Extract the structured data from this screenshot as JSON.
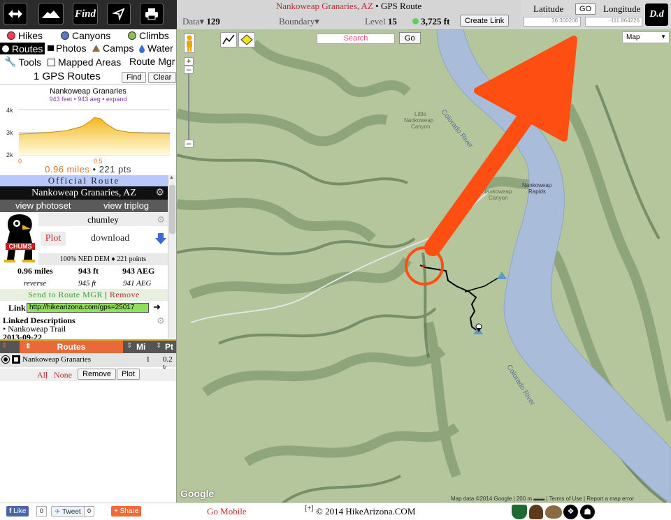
{
  "topbar": {
    "find_label": "Find",
    "title_place": "Nankoweap Granaries, AZ",
    "title_sep": " • ",
    "title_type": "GPS Route",
    "data_label": "Data",
    "data_value": "129",
    "boundary_label": "Boundary",
    "level_label": "Level",
    "level_value": "15",
    "elevation": "3,725 ft",
    "create_link": "Create Link",
    "latitude_label": "Latitude",
    "longitude_label": "Longitude",
    "go_label": "GO",
    "lat_value": "36.300206",
    "lng_value": "-111.864226",
    "dd_label": "D.d"
  },
  "categories": {
    "hikes": "Hikes",
    "canyons": "Canyons",
    "climbs": "Climbs",
    "routes": "Routes",
    "photos": "Photos",
    "camps": "Camps",
    "water": "Water",
    "tools": "Tools",
    "mapped_areas": "Mapped Areas",
    "route_mgr": "Route Mgr"
  },
  "gps": {
    "count_label": "1 GPS Routes",
    "find": "Find",
    "clear": "Clear",
    "route_name": "Nankoweap Granaries",
    "stats_small": "943 feet • 943 aeg • expand",
    "y_ticks": [
      "4k",
      "3k",
      "2k"
    ],
    "x_ticks": [
      "0",
      "0.5"
    ],
    "distance": "0.96 miles",
    "points": "221 pts"
  },
  "profile_chart": {
    "ylim_k": [
      2,
      4
    ],
    "xlim": [
      0,
      0.96
    ],
    "x": [
      0,
      0.1,
      0.2,
      0.3,
      0.4,
      0.45,
      0.48,
      0.52,
      0.56,
      0.62,
      0.7,
      0.8,
      0.9,
      0.96
    ],
    "y_k": [
      2.92,
      2.95,
      3.0,
      3.07,
      3.25,
      3.47,
      3.65,
      3.6,
      3.35,
      3.1,
      3.0,
      2.96,
      2.95,
      2.94
    ]
  },
  "route_card": {
    "official": "Official Route",
    "title": "Nankoweap Granaries, AZ",
    "view_photoset": "view photoset",
    "view_triplog": "view triplog",
    "author": "chumley",
    "logo_text": "CHUMS",
    "plot": "Plot",
    "download": "download",
    "dem": "100% NED DEM ♦ 221 points",
    "stat_miles": "0.96 miles",
    "stat_ft": "943 ft",
    "stat_aeg": "943 AEG",
    "rev_label": "reverse",
    "rev_ft": "945 ft",
    "rev_aeg": "941 AEG",
    "send_mgr": "Send to Route MGR",
    "pipe": " | ",
    "remove": "Remove",
    "link_label": "Link",
    "link_value": "http://hikearizona.com/gps=25017",
    "linked_title": "Linked Descriptions",
    "linked_item": "• Nankoweap Trail",
    "date_partial": "2013-09-22"
  },
  "routes_table": {
    "head_routes": "Routes",
    "head_mi": "Mi",
    "head_pt": "Pt",
    "row_name": "Nankoweap Granaries",
    "row_mi": "1",
    "row_pt": "0.2 k",
    "all": "All",
    "none": "None",
    "sep": " | ",
    "remove": "Remove",
    "plot": "Plot"
  },
  "map": {
    "search_placeholder": "Search",
    "go": "Go",
    "map_type": "Map",
    "google": "Google",
    "attribution": "Map data ©2014 Google | 200 m ▬▬ | Terms of Use | Report a map error",
    "labels": {
      "colorado1": "Colorado River",
      "colorado2": "Colorado River",
      "little_1": "Little",
      "little_2": "Nankoweap",
      "little_3": "Canyon",
      "nc_1": "Nankoweap",
      "nc_2": "Canyon",
      "rapids_1": "Nankoweap",
      "rapids_2": "Rapids"
    }
  },
  "footer": {
    "like": "Like",
    "like_count": "0",
    "tweet": "Tweet",
    "tweet_count": "0",
    "share": "Share",
    "go_mobile": "Go Mobile",
    "plus": "[+]",
    "copyright": "© 2014 HikeArizona.COM"
  },
  "colors": {
    "accent_orange": "#ff4e12",
    "river": "#a9bcd9",
    "terrain": "#b5c69d",
    "official_bar": "#b8c8f8",
    "routes_head": "#e86a3a",
    "link_green": "#8ce05a"
  }
}
